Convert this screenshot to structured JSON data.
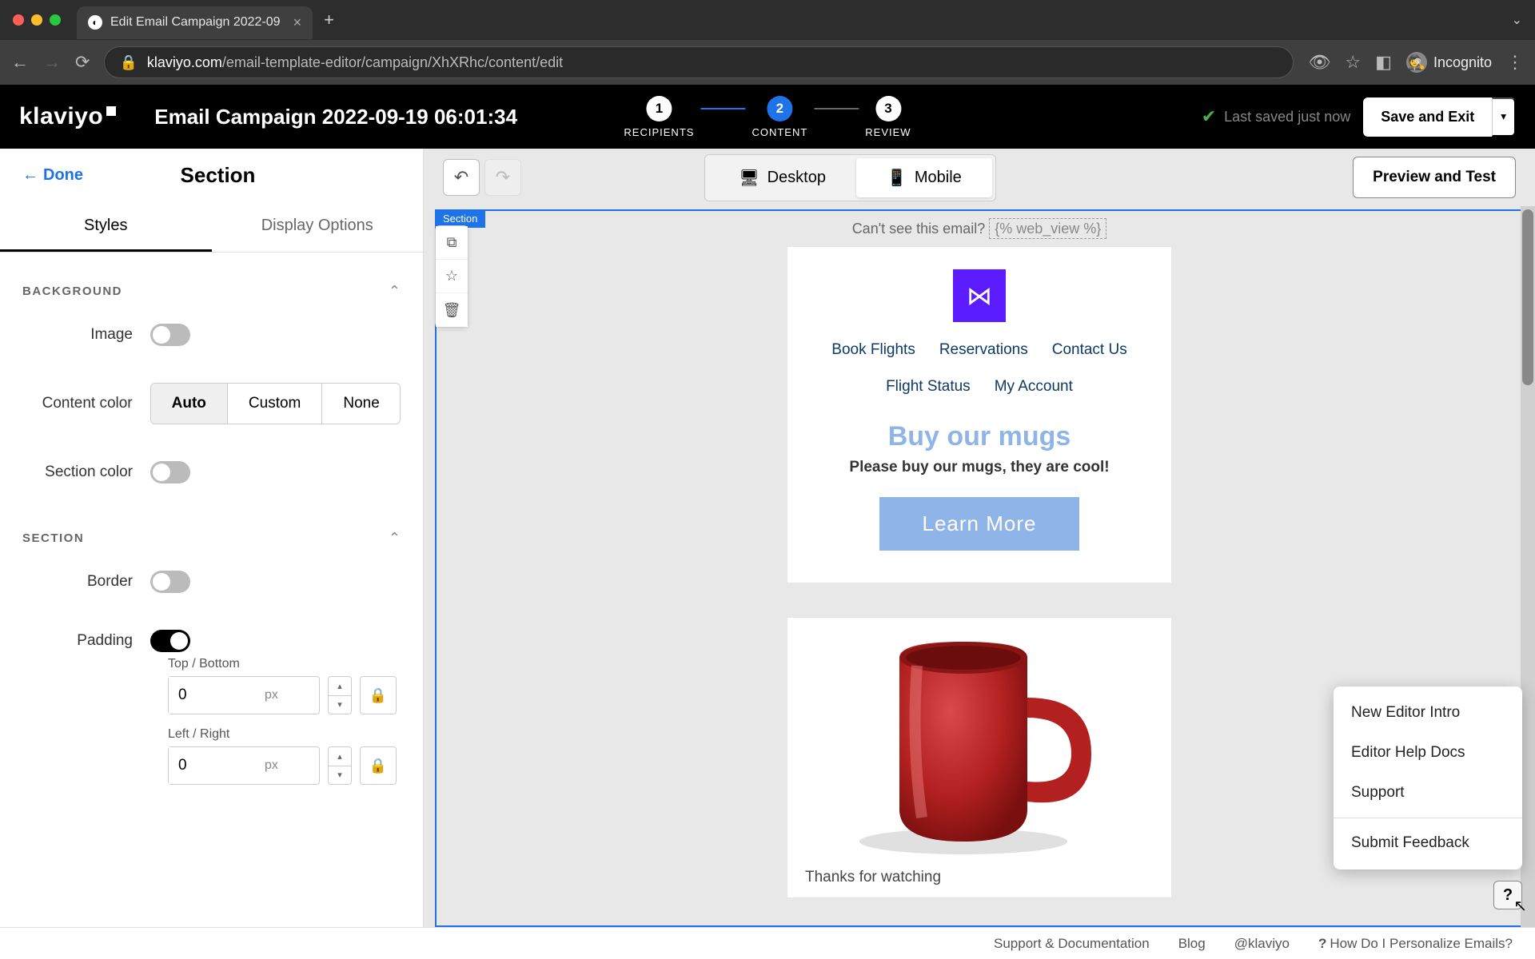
{
  "browser": {
    "tab_title": "Edit Email Campaign 2022-09",
    "url_domain": "klaviyo.com",
    "url_path": "/email-template-editor/campaign/XhXRhc/content/edit",
    "incognito_label": "Incognito"
  },
  "header": {
    "logo_text": "klaviyo",
    "title": "Email Campaign 2022-09-19 06:01:34",
    "steps": [
      {
        "num": "1",
        "label": "RECIPIENTS"
      },
      {
        "num": "2",
        "label": "CONTENT"
      },
      {
        "num": "3",
        "label": "REVIEW"
      }
    ],
    "saved_text": "Last saved just now",
    "save_exit": "Save and Exit"
  },
  "sidebar": {
    "done": "Done",
    "panel_title": "Section",
    "tabs": {
      "styles": "Styles",
      "display": "Display Options"
    },
    "background": {
      "heading": "BACKGROUND",
      "image_label": "Image",
      "content_color_label": "Content color",
      "content_color_options": {
        "auto": "Auto",
        "custom": "Custom",
        "none": "None"
      },
      "section_color_label": "Section color"
    },
    "section_group": {
      "heading": "SECTION",
      "border_label": "Border",
      "padding_label": "Padding",
      "top_bottom_label": "Top / Bottom",
      "left_right_label": "Left / Right",
      "top_bottom_value": "0",
      "left_right_value": "0",
      "unit": "px"
    }
  },
  "toolbar": {
    "desktop": "Desktop",
    "mobile": "Mobile",
    "preview_test": "Preview and Test",
    "section_badge": "Section"
  },
  "email": {
    "cant_see": "Can't see this email?",
    "web_view": "{% web_view %}",
    "nav": [
      "Book Flights",
      "Reservations",
      "Contact Us",
      "Flight Status",
      "My Account"
    ],
    "hero_title": "Buy our mugs",
    "hero_sub": "Please buy our mugs, they are cool!",
    "cta": "Learn More",
    "thanks": "Thanks for watching"
  },
  "help_menu": {
    "items": [
      "New Editor Intro",
      "Editor Help Docs",
      "Support"
    ],
    "feedback": "Submit Feedback"
  },
  "footer": {
    "support": "Support & Documentation",
    "blog": "Blog",
    "handle": "@klaviyo",
    "personalize": "How Do I Personalize Emails?"
  }
}
